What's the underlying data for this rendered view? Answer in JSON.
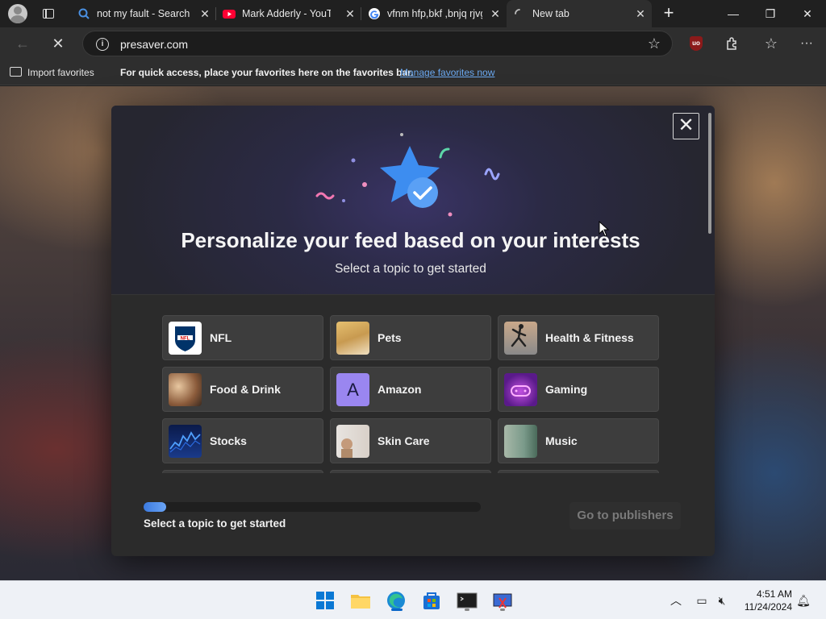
{
  "tabs": [
    {
      "title": "not my fault - Search",
      "favicon": "bing-search-icon",
      "active": false
    },
    {
      "title": "Mark Adderly - YouTube",
      "favicon": "youtube-icon",
      "active": false
    },
    {
      "title": "vfnm hfp,bkf ,bnjq rjvg",
      "favicon": "google-icon",
      "active": false
    },
    {
      "title": "New tab",
      "favicon": "loading-spinner-icon",
      "active": true
    }
  ],
  "window_controls": {
    "minimize": "—",
    "restore": "❐",
    "close": "✕"
  },
  "address_bar": {
    "url": "presaver.com"
  },
  "favorites_bar": {
    "import_label": "Import favorites",
    "hint": "For quick access, place your favorites here on the favorites bar.",
    "manage_link": "Manage favorites now"
  },
  "modal": {
    "headline": "Personalize your feed based on your interests",
    "subline": "Select a topic to get started",
    "topics": [
      {
        "name": "NFL",
        "thumb": "nfl-logo"
      },
      {
        "name": "Pets",
        "thumb": "pets-photo"
      },
      {
        "name": "Health & Fitness",
        "thumb": "fitness-photo"
      },
      {
        "name": "Food & Drink",
        "thumb": "food-photo"
      },
      {
        "name": "Amazon",
        "thumb": "amazon-letter",
        "letter": "A"
      },
      {
        "name": "Gaming",
        "thumb": "gaming-photo"
      },
      {
        "name": "Stocks",
        "thumb": "stocks-photo"
      },
      {
        "name": "Skin Care",
        "thumb": "skincare-photo"
      },
      {
        "name": "Music",
        "thumb": "music-photo"
      }
    ],
    "progress_fraction": 0.067,
    "footer_text": "Select a topic to get started",
    "publishers_button": "Go to publishers"
  },
  "taskbar": {
    "apps": [
      "windows-start-icon",
      "file-explorer-icon",
      "edge-icon",
      "microsoft-store-icon",
      "terminal-icon",
      "snipping-tool-icon"
    ],
    "time": "4:51 AM",
    "date": "11/24/2024"
  },
  "colors": {
    "accent": "#3b7ae0",
    "link": "#6aa8f0",
    "modal_bg": "#2b2b2b",
    "tile_bg": "#3d3d3d"
  }
}
